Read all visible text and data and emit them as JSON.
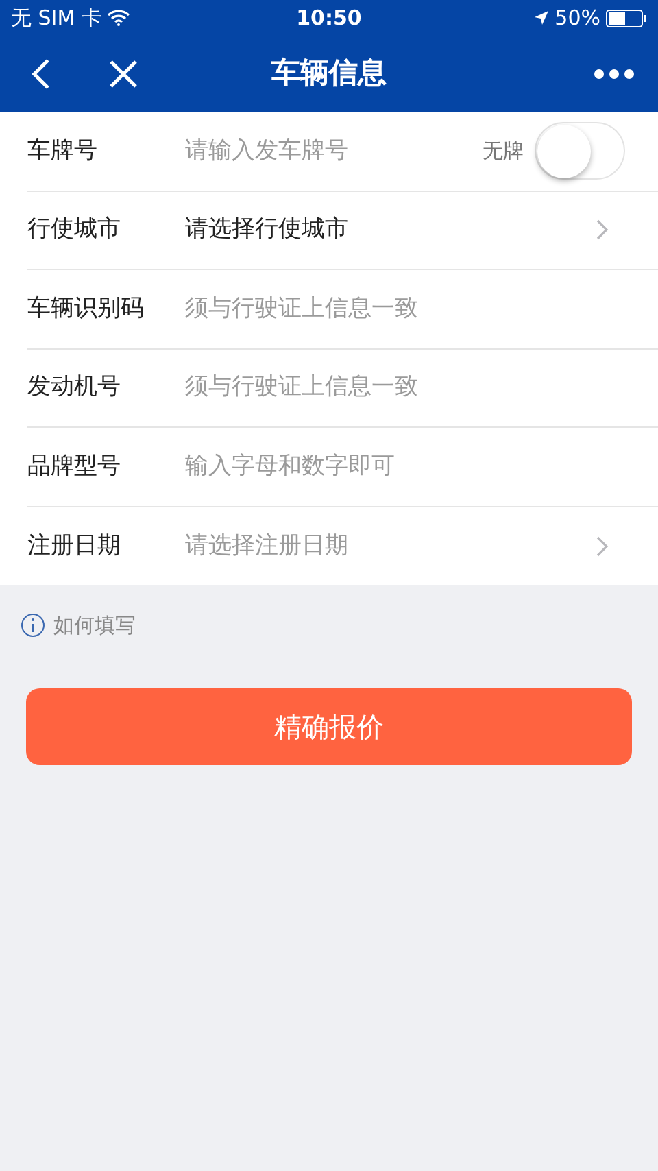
{
  "status_bar": {
    "carrier": "无 SIM 卡",
    "time": "10:50",
    "battery": "50%"
  },
  "nav": {
    "title": "车辆信息"
  },
  "form": {
    "rows": [
      {
        "kind": "toggle_input",
        "label": "车牌号",
        "placeholder": "请输入发车牌号",
        "toggle_label": "无牌",
        "on": false
      },
      {
        "kind": "select",
        "label": "行使城市",
        "value": "请选择行使城市"
      },
      {
        "kind": "input",
        "label": "车辆识别码",
        "placeholder": "须与行驶证上信息一致"
      },
      {
        "kind": "input",
        "label": "发动机号",
        "placeholder": "须与行驶证上信息一致"
      },
      {
        "kind": "input",
        "label": "品牌型号",
        "placeholder": "输入字母和数字即可"
      },
      {
        "kind": "select",
        "label": "注册日期",
        "placeholder": "请选择注册日期"
      }
    ]
  },
  "help_link": "如何填写",
  "submit_button": "精确报价"
}
